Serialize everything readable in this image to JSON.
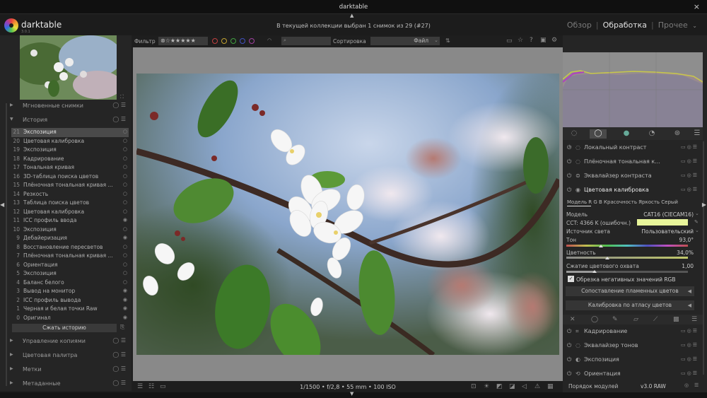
{
  "window": {
    "title": "darktable",
    "close_icon": "×"
  },
  "header": {
    "app_name": "darktable",
    "app_version": "3.0.1",
    "collection_info": "В текущей коллекции выбран 1 снимок из 29 (#27)",
    "views": [
      "Обзор",
      "Обработка",
      "Прочее"
    ],
    "active_view": "Обработка"
  },
  "left": {
    "sections_top": [
      {
        "label": "Мгновенные снимки"
      },
      {
        "label": "История"
      }
    ],
    "history": [
      {
        "n": "21",
        "label": "Экспозиция",
        "state": "○"
      },
      {
        "n": "20",
        "label": "Цветовая калибровка",
        "state": "○"
      },
      {
        "n": "19",
        "label": "Экспозиция",
        "state": "○"
      },
      {
        "n": "18",
        "label": "Кадрирование",
        "state": "○"
      },
      {
        "n": "17",
        "label": "Тональная кривая",
        "state": "○"
      },
      {
        "n": "16",
        "label": "3D-таблица поиска цветов",
        "state": "○"
      },
      {
        "n": "15",
        "label": "Плёночная тональная кривая ...",
        "state": "○"
      },
      {
        "n": "14",
        "label": "Резкость",
        "state": "○"
      },
      {
        "n": "13",
        "label": "Таблица поиска цветов",
        "state": "○"
      },
      {
        "n": "12",
        "label": "Цветовая калибровка",
        "state": "○"
      },
      {
        "n": "11",
        "label": "ICC профиль ввода",
        "state": "◉"
      },
      {
        "n": "10",
        "label": "Экспозиция",
        "state": "○"
      },
      {
        "n": "9",
        "label": "Дебайеризация",
        "state": "◉"
      },
      {
        "n": "8",
        "label": "Восстановление пересветов",
        "state": "○"
      },
      {
        "n": "7",
        "label": "Плёночная тональная кривая ...",
        "state": "○"
      },
      {
        "n": "6",
        "label": "Ориентация",
        "state": "○"
      },
      {
        "n": "5",
        "label": "Экспозиция",
        "state": "○"
      },
      {
        "n": "4",
        "label": "Баланс белого",
        "state": "○"
      },
      {
        "n": "3",
        "label": "Вывод на монитор",
        "state": "◉"
      },
      {
        "n": "2",
        "label": "ICC профиль вывода",
        "state": "◉"
      },
      {
        "n": "1",
        "label": "Черная и белая точки Raw",
        "state": "◉"
      },
      {
        "n": "0",
        "label": "Оригинал",
        "state": "◉"
      }
    ],
    "compress_button": "Сжать историю",
    "sections_bottom": [
      {
        "label": "Управление копиями"
      },
      {
        "label": "Цветовая палитра"
      },
      {
        "label": "Метки"
      },
      {
        "label": "Метаданные"
      }
    ]
  },
  "toolbar": {
    "filter_label": "Фильтр",
    "stars": "⊗☆★★★★★",
    "sort_label": "Сортировка",
    "sort_value": "Файл",
    "color_labels": [
      "#c04040",
      "#c0a030",
      "#40a040",
      "#4050c0",
      "#a040a0"
    ]
  },
  "center": {
    "exif_info": "1/1500 • f/2,8 • 55 mm • 100 ISO"
  },
  "right": {
    "modules_top": [
      {
        "label": "Локальный контраст"
      },
      {
        "label": "Плёночная тональная к..."
      },
      {
        "label": "Эквалайзер контраста"
      },
      {
        "label": "Цветовая калибровка"
      }
    ],
    "cc_tabs": "Модель  R  G  B  Красочность  Яркость  Серый",
    "controls": {
      "model_label": "Модель",
      "model_value": "CAT16 (CIECAM16)",
      "cct_label": "CCT: 4366 K (ошибочн.)",
      "illuminant_label": "Источник света",
      "illuminant_value": "Пользовательский",
      "hue_label": "Тон",
      "hue_value": "93,0°",
      "chroma_label": "Цветность",
      "chroma_value": "34,0%",
      "gamut_label": "Сжатие цветового охвата",
      "gamut_value": "1,00",
      "clip_label": "Обрезка негативных значений RGB"
    },
    "buttons": [
      "Сопоставление пламенных цветов",
      "Калибровка по атласу цветов"
    ],
    "modules_bottom": [
      {
        "label": "Кадрирование"
      },
      {
        "label": "Эквалайзер тонов"
      },
      {
        "label": "Экспозиция"
      },
      {
        "label": "Ориентация"
      }
    ],
    "module_order_label": "Порядок модулей",
    "module_order_value": "v3.0 RAW"
  }
}
